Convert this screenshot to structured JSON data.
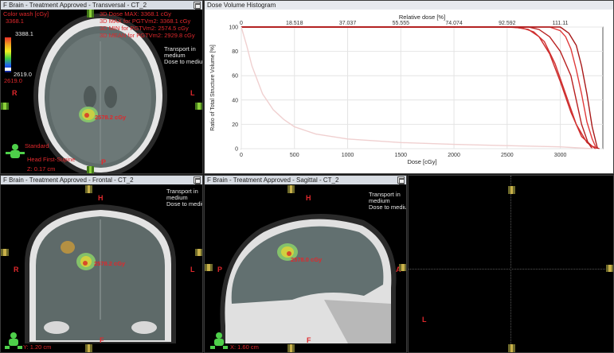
{
  "panes": {
    "transversal": {
      "title": "F Brain  -  Treatment Approved - Transversal - CT_2",
      "colorwash_label": "Color wash [cGy]",
      "colorwash_max": "3368.1",
      "colorwash_top": "3388.1",
      "colorwash_mid": "2619.0",
      "colorwash_low": "2619.0",
      "dose_lines": [
        "3D Dose MAX: 3368.1 cGy",
        "3D MAX for PGTVm2: 3368.1 cGy",
        "3D MIN for PGTVm2: 2574.5 cGy",
        "3D MEAN for PGTVm2: 2929.8 cGy"
      ],
      "transport_lines": [
        "Transport in",
        "medium",
        "Dose to medium"
      ],
      "point_dose": "2578.2 cGy",
      "orient": {
        "R": "R",
        "L": "L",
        "P": "P"
      },
      "patient_lines": [
        "Standard",
        "Head First-Supine",
        "Z: 0.17 cm"
      ]
    },
    "dvh": {
      "title": "Dose Volume Histogram"
    },
    "frontal": {
      "title": "F Brain  -  Treatment Approved - Frontal - CT_2",
      "transport_lines": [
        "Transport in",
        "medium",
        "Dose to medium"
      ],
      "point_dose": "2578.2 cGy",
      "orient": {
        "H": "H",
        "R": "R",
        "L": "L",
        "F": "F"
      },
      "coord": "Y: 1.20 cm"
    },
    "sagittal": {
      "title": "F Brain  -  Treatment Approved - Sagittal - CT_2",
      "transport_lines": [
        "Transport in",
        "medium",
        "Dose to medium"
      ],
      "point_dose": "2578.0 cGy",
      "orient": {
        "H": "H",
        "P": "P",
        "A": "A",
        "F": "F"
      },
      "coord": "X: 1.60 cm"
    },
    "empty": {
      "orient": {
        "L": "L"
      }
    }
  },
  "chart_data": {
    "type": "line",
    "title": "Dose Volume Histogram",
    "xlabel": "Dose [cGy]",
    "ylabel": "Ratio of Total Structure Volume [%]",
    "x2label": "Relative dose [%]",
    "xlim": [
      0,
      3400
    ],
    "ylim": [
      0,
      100
    ],
    "x_ticks": [
      "0",
      "500",
      "1000",
      "1500",
      "2000",
      "2500",
      "3000"
    ],
    "x_tick_values": [
      0,
      500,
      1000,
      1500,
      2000,
      2500,
      3000
    ],
    "y_ticks": [
      "0",
      "20",
      "40",
      "60",
      "80",
      "100"
    ],
    "y_tick_values": [
      0,
      20,
      40,
      60,
      80,
      100
    ],
    "x2_ticks": [
      "0",
      "18.518",
      "37.037",
      "55.555",
      "74.074",
      "92.592",
      "111.11"
    ],
    "x2_tick_values": [
      0,
      500,
      1000,
      1500,
      2000,
      2500,
      3000
    ],
    "grid": true,
    "series": [
      {
        "color": "#cc2b2b",
        "x": [
          0,
          2500,
          2600,
          2700,
          2800,
          2900,
          3000,
          3100,
          3200,
          3300,
          3368
        ],
        "y": [
          100,
          100,
          99.5,
          98,
          92,
          78,
          55,
          30,
          10,
          2,
          0
        ]
      },
      {
        "color": "#d13030",
        "x": [
          0,
          2550,
          2650,
          2750,
          2850,
          2950,
          3050,
          3150,
          3250,
          3330
        ],
        "y": [
          100,
          100,
          99,
          96,
          88,
          70,
          45,
          20,
          5,
          0
        ]
      },
      {
        "color": "#b82020",
        "x": [
          0,
          2700,
          2800,
          2900,
          3000,
          3100,
          3150,
          3200,
          3260,
          3300
        ],
        "y": [
          100,
          100,
          98,
          92,
          80,
          60,
          40,
          20,
          5,
          0
        ]
      },
      {
        "color": "#e03a3a",
        "x": [
          0,
          2900,
          3000,
          3050,
          3100,
          3150,
          3200,
          3250,
          3300,
          3340
        ],
        "y": [
          100,
          100,
          97,
          92,
          82,
          65,
          45,
          22,
          8,
          0
        ]
      },
      {
        "color": "#a81818",
        "x": [
          0,
          3000,
          3080,
          3150,
          3200,
          3250,
          3300,
          3350
        ],
        "y": [
          100,
          100,
          95,
          85,
          68,
          45,
          18,
          0
        ]
      },
      {
        "color": "#f0d0d0",
        "x": [
          0,
          50,
          100,
          200,
          300,
          400,
          500,
          700,
          1000,
          1500,
          2000,
          2500,
          3000,
          3300
        ],
        "y": [
          100,
          85,
          68,
          45,
          32,
          24,
          18,
          12,
          8,
          5,
          3.5,
          2.5,
          1.5,
          0
        ]
      }
    ]
  }
}
